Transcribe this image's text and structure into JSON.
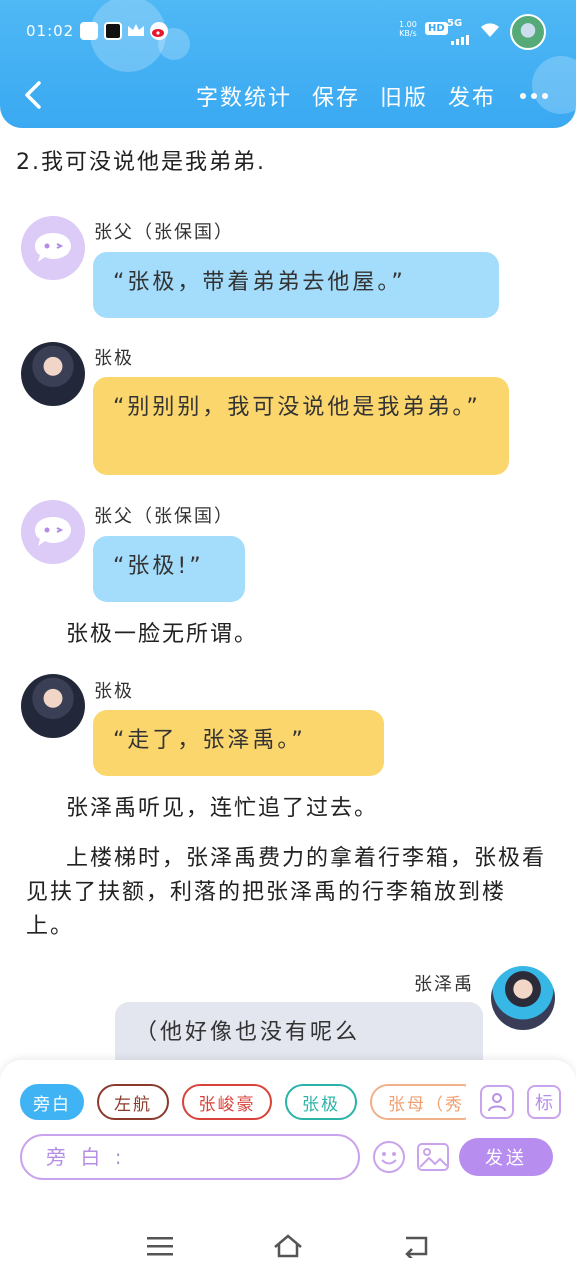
{
  "status_bar": {
    "time": "01:02",
    "net_speed_value": "1.00",
    "net_speed_unit": "KB/s",
    "hd": "HD",
    "network": "5G"
  },
  "nav": {
    "actions": [
      "字数统计",
      "保存",
      "旧版",
      "发布"
    ]
  },
  "colors": {
    "header_blue": "#3aa9f2",
    "bubble_blue": "#a4dcfb",
    "bubble_yellow": "#fbd66c",
    "bubble_grey": "#e3e6ee",
    "accent_purple": "#b78df0"
  },
  "content": {
    "intro": "2.我可没说他是我弟弟.",
    "messages": [
      {
        "speaker": "张父（张保国）",
        "text": "“张极，带着弟弟去他屋。”",
        "color": "blue",
        "avatar": "chat-bubble-icon"
      },
      {
        "speaker": "张极",
        "text": "“别别别，我可没说他是我弟弟。”",
        "color": "yellow",
        "avatar": "photo"
      },
      {
        "speaker": "张父（张保国）",
        "text": "“张极!”",
        "color": "blue",
        "avatar": "chat-bubble-icon"
      },
      {
        "narration": "张极一脸无所谓。"
      },
      {
        "speaker": "张极",
        "text": "“走了，张泽禹。”",
        "color": "yellow",
        "avatar": "photo"
      },
      {
        "narration": "张泽禹听见，连忙追了过去。"
      },
      {
        "narration": "上楼梯时，张泽禹费力的拿着行李箱，张极看见扶了扶额，利落的把张泽禹的行李箱放到楼上。"
      },
      {
        "speaker": "张泽禹",
        "text": "（他好像也没有呢么",
        "color": "grey",
        "avatar": "photo"
      }
    ]
  },
  "panel": {
    "roles": [
      "旁白",
      "左航",
      "张峻豪",
      "张极",
      "张母（秀"
    ],
    "role_colors": [
      "#3fb3f3",
      "#8b3a2b",
      "#d9423a",
      "#2bb3a8",
      "#f0a070"
    ],
    "icon_tag": "标",
    "input_placeholder": "旁 白 :",
    "send": "发送"
  }
}
